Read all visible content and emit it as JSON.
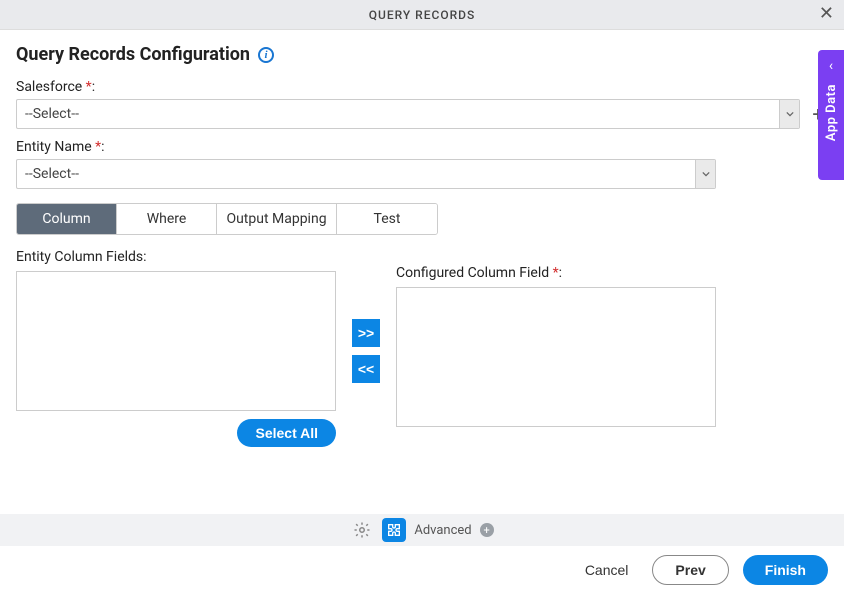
{
  "header": {
    "title": "QUERY RECORDS"
  },
  "page": {
    "title": "Query Records Configuration"
  },
  "fields": {
    "salesforce": {
      "label": "Salesforce ",
      "required_marker": "*",
      "colon": ":",
      "value": "--Select--"
    },
    "entity": {
      "label": "Entity Name ",
      "required_marker": "*",
      "colon": ":",
      "value": "--Select--"
    }
  },
  "tabs": [
    "Column",
    "Where",
    "Output Mapping",
    "Test"
  ],
  "active_tab": "Column",
  "columns": {
    "left_label": "Entity Column Fields:",
    "right_label": "Configured Column Field ",
    "right_required": "*",
    "right_colon": ":",
    "select_all": "Select All",
    "move_right": ">>",
    "move_left": "<<"
  },
  "side_panel": {
    "label": "App Data",
    "chevron": "‹"
  },
  "advanced": {
    "label": "Advanced"
  },
  "footer": {
    "cancel": "Cancel",
    "prev": "Prev",
    "finish": "Finish"
  }
}
